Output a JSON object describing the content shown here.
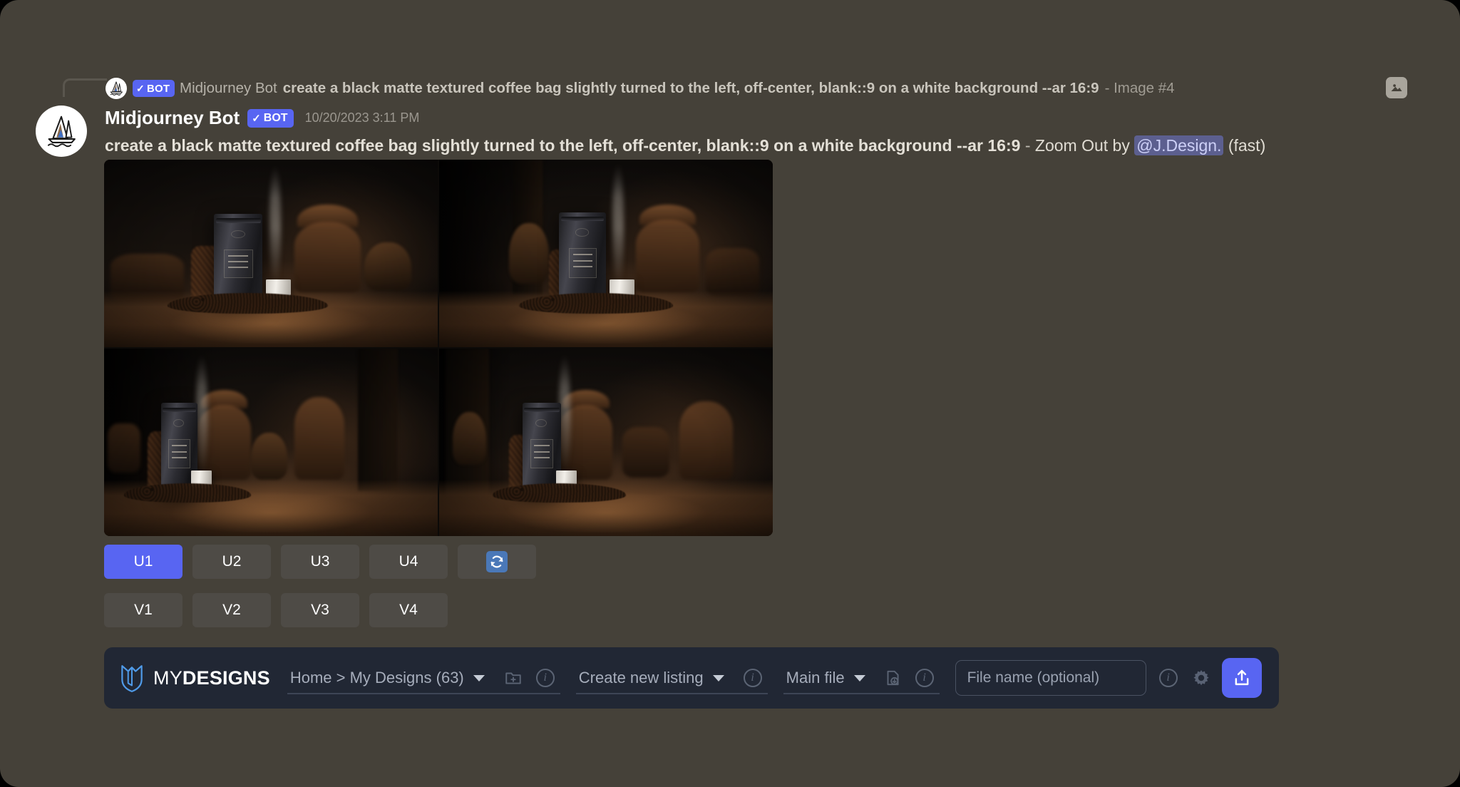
{
  "theme": {
    "app_background": "#454139",
    "accent_blurple": "#5865f2",
    "button_grey": "#4e4b46",
    "toolbar_background": "#212734",
    "mention_background": "#5c5f8f"
  },
  "reply_preview": {
    "avatar_icon": "midjourney-sailboat-icon",
    "bot_badge": {
      "check": "✓",
      "label": "BOT"
    },
    "username": "Midjourney Bot",
    "prompt": "create a black matte textured coffee bag slightly turned to the left, off-center, blank::9 on a white background --ar 16:9",
    "suffix": "- Image #4",
    "attachment_icon": "image-icon"
  },
  "message": {
    "avatar_icon": "midjourney-sailboat-icon",
    "author": "Midjourney Bot",
    "bot_badge": {
      "check": "✓",
      "label": "BOT"
    },
    "timestamp": "10/20/2023 3:11 PM",
    "prompt": "create a black matte textured coffee bag slightly turned to the left, off-center, blank::9 on a white background --ar 16:9",
    "separator": "-",
    "action": "Zoom Out by",
    "mention": "@J.Design.",
    "mode": "(fast)"
  },
  "image_grid": {
    "alt": "2x2 grid of AI generated black matte coffee bag product photos on a dark wooden table with coffee beans, a white cup and steam",
    "cells": [
      {
        "index": 1,
        "label": "top-left"
      },
      {
        "index": 2,
        "label": "top-right"
      },
      {
        "index": 3,
        "label": "bottom-left"
      },
      {
        "index": 4,
        "label": "bottom-right"
      }
    ]
  },
  "action_buttons": {
    "upscale_row": [
      {
        "label": "U1",
        "primary": true
      },
      {
        "label": "U2",
        "primary": false
      },
      {
        "label": "U3",
        "primary": false
      },
      {
        "label": "U4",
        "primary": false
      }
    ],
    "reroll": {
      "icon": "refresh-icon",
      "label": ""
    },
    "variation_row": [
      {
        "label": "V1",
        "primary": false
      },
      {
        "label": "V2",
        "primary": false
      },
      {
        "label": "V3",
        "primary": false
      },
      {
        "label": "V4",
        "primary": false
      }
    ]
  },
  "mydesigns_toolbar": {
    "brand": {
      "prefix": "MY",
      "suffix": "DESIGNS",
      "icon": "mydesigns-shield-icon"
    },
    "folder_select": {
      "value": "Home > My Designs (63)",
      "dropdown_icon": "chevron-down-icon",
      "new_folder_icon": "folder-plus-icon",
      "info_icon": "info-icon"
    },
    "listing_select": {
      "value": "Create new listing",
      "dropdown_icon": "chevron-down-icon",
      "info_icon": "info-icon"
    },
    "file_select": {
      "value": "Main file",
      "dropdown_icon": "chevron-down-icon",
      "add_file_icon": "file-plus-icon",
      "info_icon": "info-icon"
    },
    "file_name_input": {
      "value": "",
      "placeholder": "File name (optional)",
      "info_icon": "info-icon"
    },
    "settings_icon": "gear-icon",
    "upload_button": {
      "icon": "upload-icon",
      "label": ""
    }
  }
}
